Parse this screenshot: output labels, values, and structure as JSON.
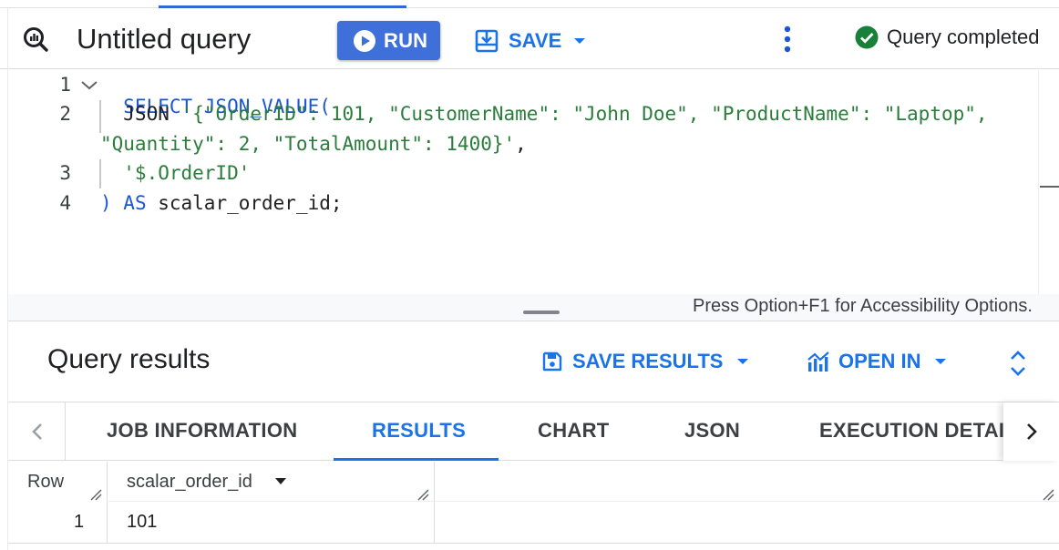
{
  "toolbar": {
    "title": "Untitled query",
    "run_label": "RUN",
    "save_label": "SAVE",
    "status_text": "Query completed"
  },
  "editor": {
    "line_numbers": [
      "1",
      "2",
      "3",
      "4"
    ],
    "lines": {
      "l1_kw": "SELECT JSON_VALUE(",
      "l2_plain": "  JSON ",
      "l2_str": "'{\"OrderID\": 101, \"CustomerName\": \"John Doe\", \"ProductName\": \"Laptop\",",
      "l2b_str": "\"Quantity\": 2, \"TotalAmount\": 1400}'",
      "l2b_plain": ",",
      "l3_str": "  '$.OrderID'",
      "l4_kw1": ")",
      "l4_kw2": " AS",
      "l4_plain": " scalar_order_id;"
    },
    "accessibility_hint": "Press Option+F1 for Accessibility Options."
  },
  "results": {
    "title": "Query results",
    "save_results_label": "SAVE RESULTS",
    "open_in_label": "OPEN IN"
  },
  "tabs": {
    "items": [
      "JOB INFORMATION",
      "RESULTS",
      "CHART",
      "JSON",
      "EXECUTION DETAILS"
    ],
    "active": "RESULTS"
  },
  "table": {
    "columns": [
      "Row",
      "scalar_order_id"
    ],
    "rows": [
      [
        "1",
        "101"
      ]
    ]
  },
  "colors": {
    "accent": "#1a73e8",
    "run_button": "#3f6fd8",
    "success": "#188038",
    "keyword": "#1a55d6",
    "string": "#2a7d3a"
  },
  "icons": {
    "query": "magnifier-query-icon",
    "run": "play-circle-icon",
    "save": "save-download-icon",
    "more": "more-vert-icon",
    "status": "check-circle-icon",
    "save_results": "floppy-disk-icon",
    "open_in": "analytics-chart-icon",
    "expand": "unfold-more-icon",
    "tab_prev": "chevron-left-icon",
    "tab_next": "chevron-right-icon"
  }
}
